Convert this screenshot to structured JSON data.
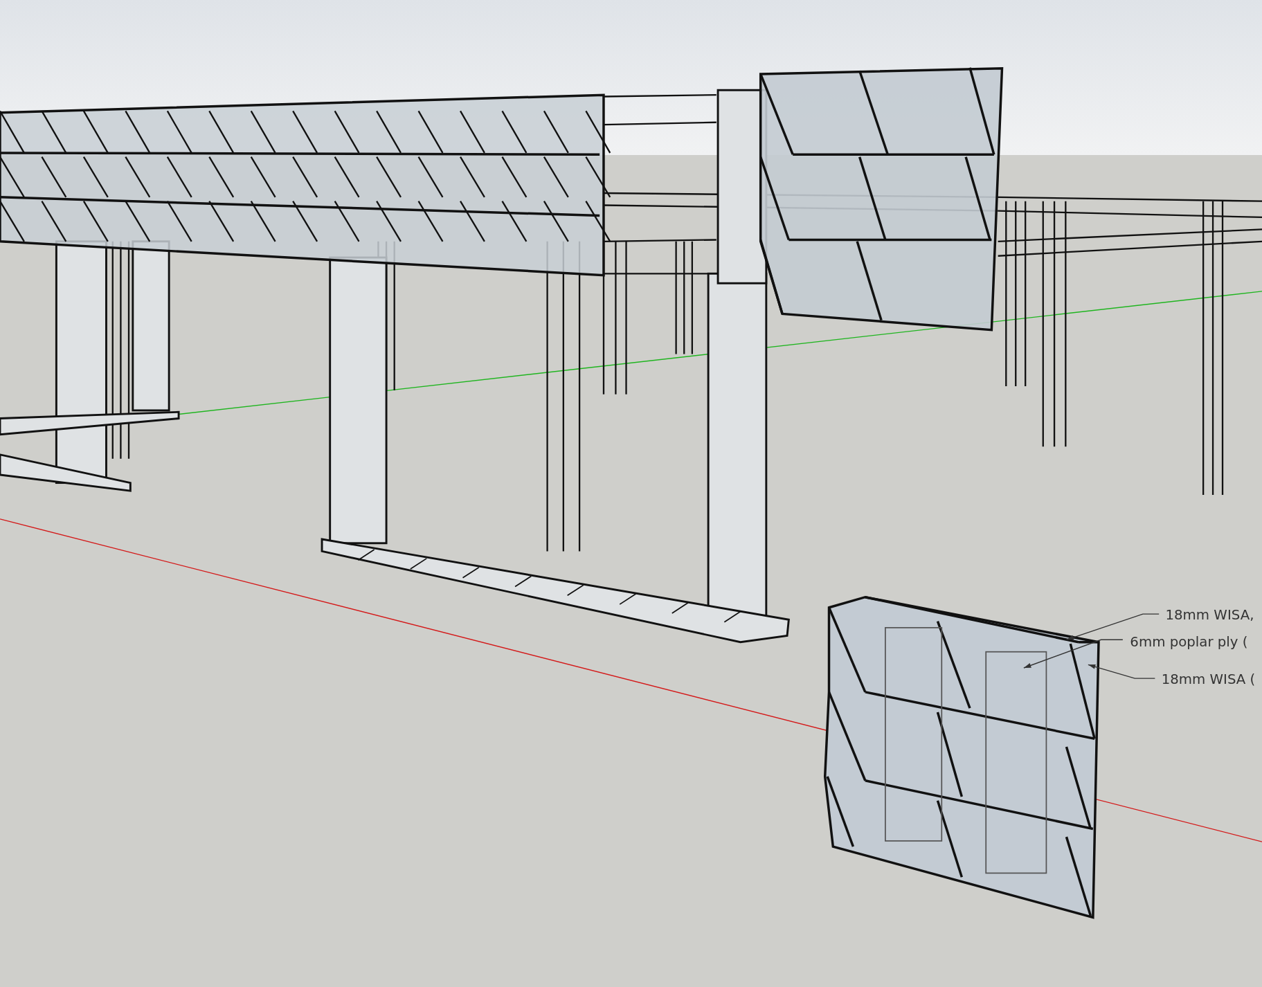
{
  "viewport": {
    "annotations": [
      {
        "text": "18mm WISA,"
      },
      {
        "text": "6mm poplar ply ("
      },
      {
        "text": "18mm WISA ("
      }
    ]
  }
}
